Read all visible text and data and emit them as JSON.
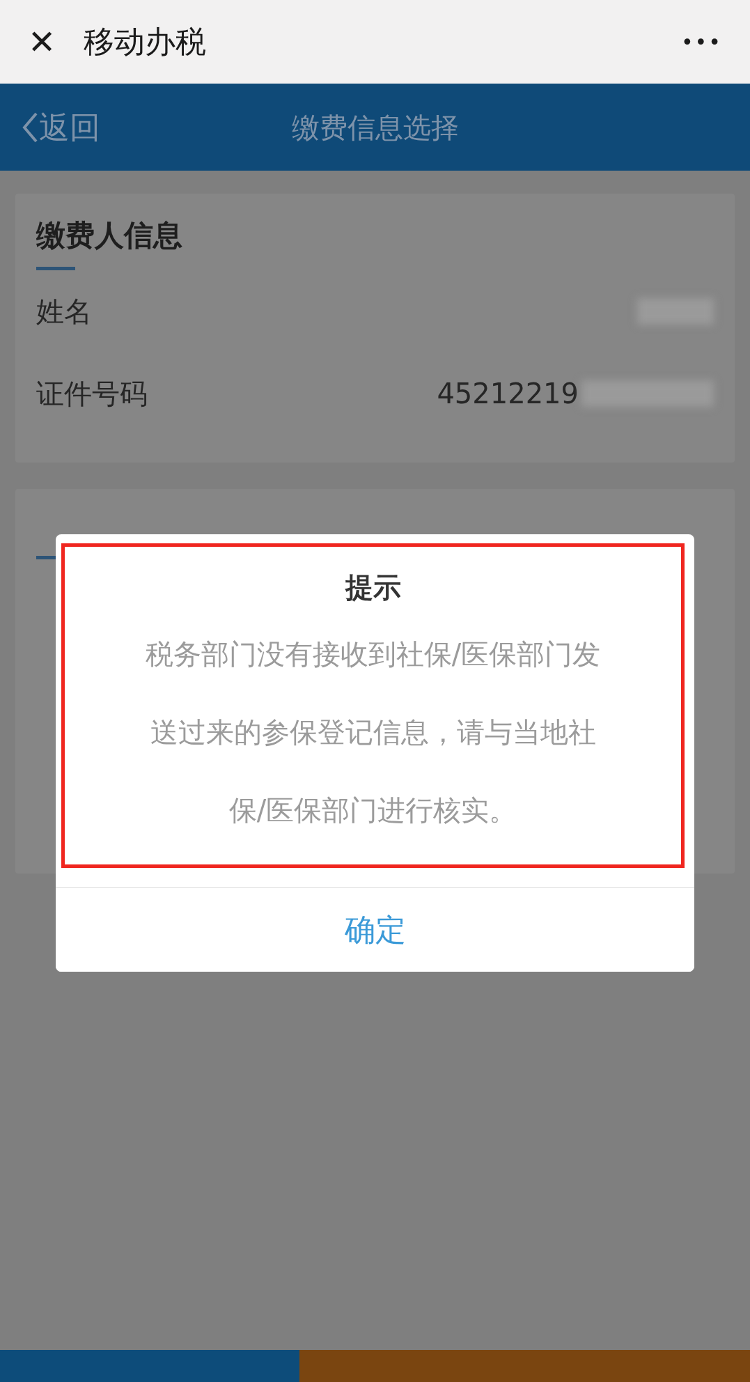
{
  "window": {
    "title": "移动办税",
    "close_icon": "✕",
    "more_icon": "•••"
  },
  "nav_bar": {
    "back_label": "返回",
    "title": "缴费信息选择"
  },
  "payer_card": {
    "heading": "缴费人信息",
    "rows": [
      {
        "label": "姓名",
        "redacted": true
      },
      {
        "label": "证件号码",
        "value": "45212219",
        "redacted": true
      }
    ]
  },
  "payment_card": {
    "underline": true
  },
  "dialog": {
    "title": "提示",
    "message_lines": [
      "税务部门没有接收到社保/医保部门发",
      "送过来的参保登记信息，请与当地社",
      "保/医保部门进行核实。"
    ],
    "highlighted": true,
    "confirm": "确定"
  },
  "bottom_bar": [
    {
      "kind": "secondary"
    },
    {
      "kind": "primary"
    }
  ]
}
